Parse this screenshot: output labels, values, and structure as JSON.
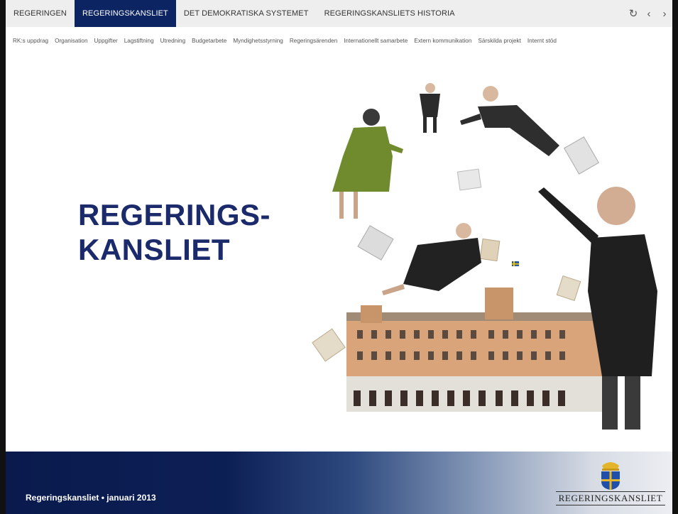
{
  "topnav": {
    "tabs": [
      {
        "label": "REGERINGEN",
        "active": false
      },
      {
        "label": "REGERINGSKANSLIET",
        "active": true
      },
      {
        "label": "DET DEMOKRATISKA SYSTEMET",
        "active": false
      },
      {
        "label": "REGERINGSKANSLIETS HISTORIA",
        "active": false
      }
    ],
    "controls": {
      "refresh": "↻",
      "prev": "‹",
      "next": "›"
    }
  },
  "subnav": [
    "RK:s uppdrag",
    "Organisation",
    "Uppgifter",
    "Lagstiftning",
    "Utredning",
    "Budgetarbete",
    "Myndighetsstyrning",
    "Regeringsärenden",
    "Internationellt samarbete",
    "Extern kommunikation",
    "Särskilda projekt",
    "Internt stöd"
  ],
  "slide": {
    "title_line1": "REGERINGS-",
    "title_line2": "KANSLIET"
  },
  "footer": {
    "meta": "Regeringskansliet  •  januari 2013",
    "logo_text": "REGERINGSKANSLIET"
  },
  "colors": {
    "brand_blue": "#0c2461",
    "title_blue": "#1b2a6b"
  }
}
